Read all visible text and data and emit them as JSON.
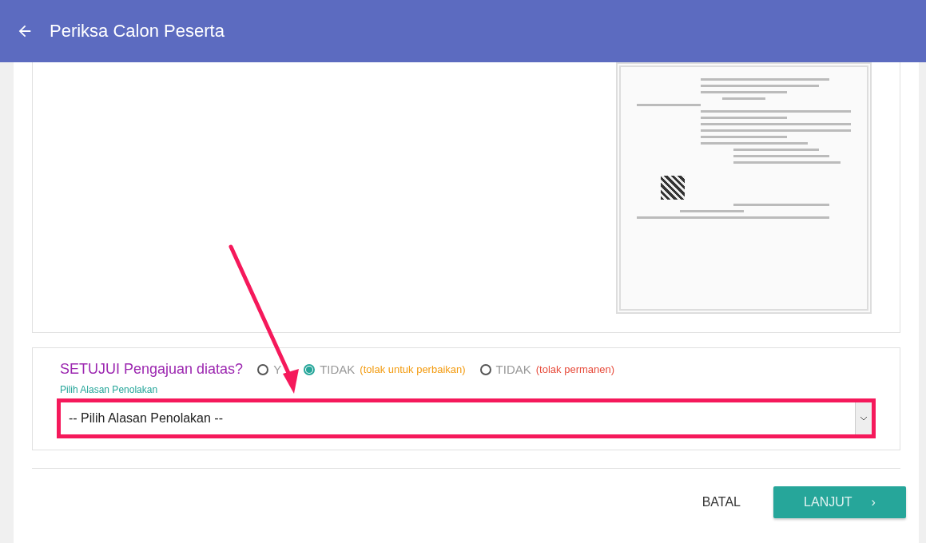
{
  "header": {
    "title": "Periksa Calon Peserta"
  },
  "approval": {
    "question": "SETUJUI Pengajuan diatas?",
    "options": [
      {
        "label": "Y",
        "selected": false
      },
      {
        "label": "TIDAK",
        "note": "(tolak untuk perbaikan)",
        "color": "#f39c12",
        "selected": true
      },
      {
        "label": "TIDAK",
        "note": "(tolak permanen)",
        "color": "#e74c3c",
        "selected": false
      }
    ],
    "reason_label": "Pilih Alasan Penolakan",
    "reason_value": "-- Pilih Alasan Penolakan --"
  },
  "actions": {
    "cancel": "BATAL",
    "next": "LANJUT",
    "next_icon": "›"
  }
}
